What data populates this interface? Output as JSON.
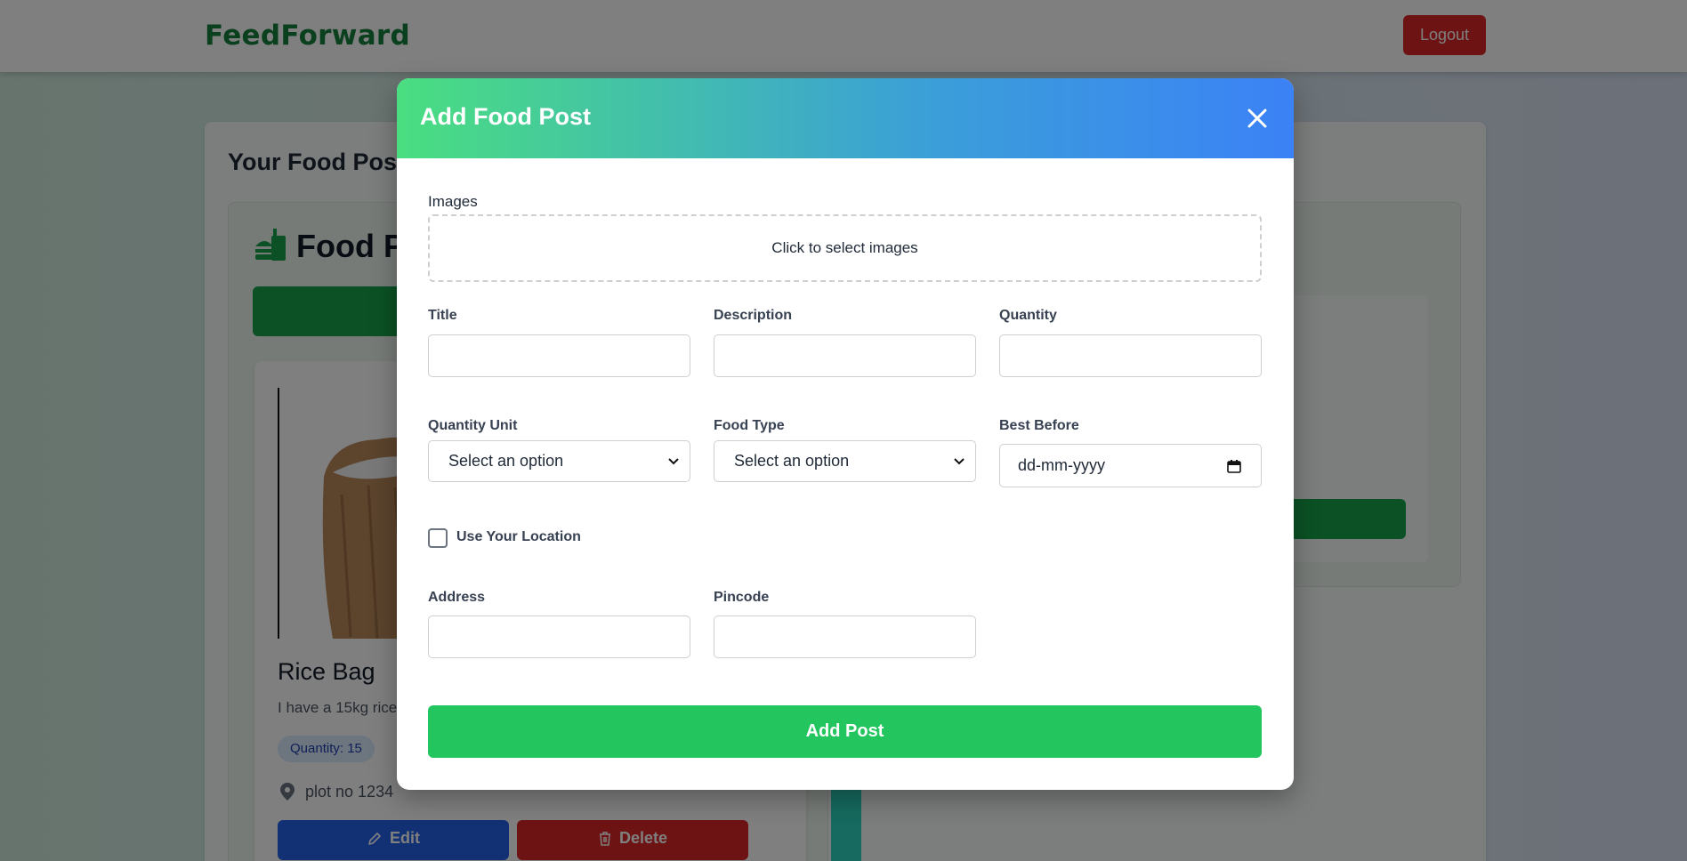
{
  "navbar": {
    "brand": "FeedForward",
    "logout_label": "Logout"
  },
  "page": {
    "title": "Your Food Post",
    "section_title": "Food Po",
    "card": {
      "title": "Rice Bag",
      "description": "I have a 15kg rice",
      "quantity_badge": "Quantity: 15",
      "location": "plot no 1234",
      "edit_label": "Edit",
      "delete_label": "Delete"
    }
  },
  "modal": {
    "title": "Add Food Post",
    "images_label": "Images",
    "images_dropzone": "Click to select images",
    "title_label": "Title",
    "description_label": "Description",
    "quantity_label": "Quantity",
    "quantity_unit_label": "Quantity Unit",
    "quantity_unit_value": "Select an option",
    "food_type_label": "Food Type",
    "food_type_value": "Select an option",
    "best_before_label": "Best Before",
    "best_before_placeholder": "dd-mm-yyyy",
    "use_location_label": "Use Your Location",
    "address_label": "Address",
    "pincode_label": "Pincode",
    "submit_label": "Add Post"
  },
  "colors": {
    "brand": "#15803d",
    "header_gradient_start": "#4ade80",
    "header_gradient_end": "#3b82f6",
    "submit": "#22c55e",
    "edit": "#2563eb",
    "delete": "#dc2626"
  }
}
